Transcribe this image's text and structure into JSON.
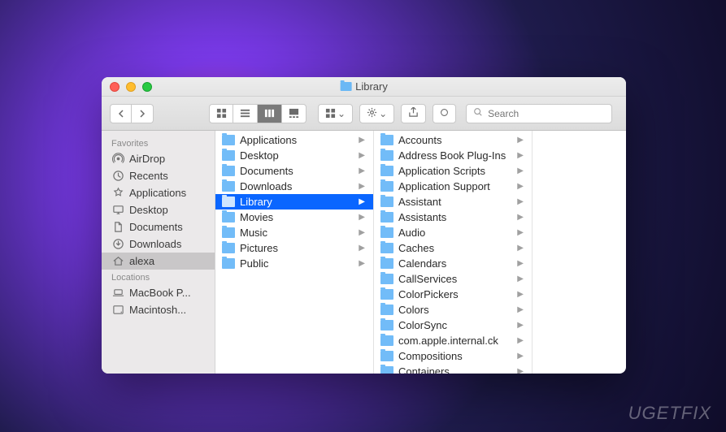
{
  "window": {
    "title": "Library"
  },
  "toolbar": {
    "search_placeholder": "Search"
  },
  "sidebar": {
    "sections": [
      {
        "heading": "Favorites",
        "items": [
          {
            "icon": "airdrop",
            "label": "AirDrop"
          },
          {
            "icon": "recents",
            "label": "Recents"
          },
          {
            "icon": "applications",
            "label": "Applications"
          },
          {
            "icon": "desktop",
            "label": "Desktop"
          },
          {
            "icon": "documents",
            "label": "Documents"
          },
          {
            "icon": "downloads",
            "label": "Downloads"
          },
          {
            "icon": "home",
            "label": "alexa",
            "selected": true
          }
        ]
      },
      {
        "heading": "Locations",
        "items": [
          {
            "icon": "laptop",
            "label": "MacBook P..."
          },
          {
            "icon": "disk",
            "label": "Macintosh..."
          }
        ]
      }
    ]
  },
  "columns": [
    {
      "items": [
        {
          "label": "Applications",
          "has_children": true
        },
        {
          "label": "Desktop",
          "has_children": true
        },
        {
          "label": "Documents",
          "has_children": true
        },
        {
          "label": "Downloads",
          "has_children": true
        },
        {
          "label": "Library",
          "has_children": true,
          "selected": true
        },
        {
          "label": "Movies",
          "has_children": true
        },
        {
          "label": "Music",
          "has_children": true
        },
        {
          "label": "Pictures",
          "has_children": true
        },
        {
          "label": "Public",
          "has_children": true
        }
      ]
    },
    {
      "items": [
        {
          "label": "Accounts",
          "has_children": true
        },
        {
          "label": "Address Book Plug-Ins",
          "has_children": true
        },
        {
          "label": "Application Scripts",
          "has_children": true
        },
        {
          "label": "Application Support",
          "has_children": true
        },
        {
          "label": "Assistant",
          "has_children": true
        },
        {
          "label": "Assistants",
          "has_children": true
        },
        {
          "label": "Audio",
          "has_children": true
        },
        {
          "label": "Caches",
          "has_children": true
        },
        {
          "label": "Calendars",
          "has_children": true
        },
        {
          "label": "CallServices",
          "has_children": true
        },
        {
          "label": "ColorPickers",
          "has_children": true
        },
        {
          "label": "Colors",
          "has_children": true
        },
        {
          "label": "ColorSync",
          "has_children": true
        },
        {
          "label": "com.apple.internal.ck",
          "has_children": true
        },
        {
          "label": "Compositions",
          "has_children": true
        },
        {
          "label": "Containers",
          "has_children": true
        }
      ]
    },
    {
      "items": []
    }
  ],
  "watermark": "UGETFIX"
}
